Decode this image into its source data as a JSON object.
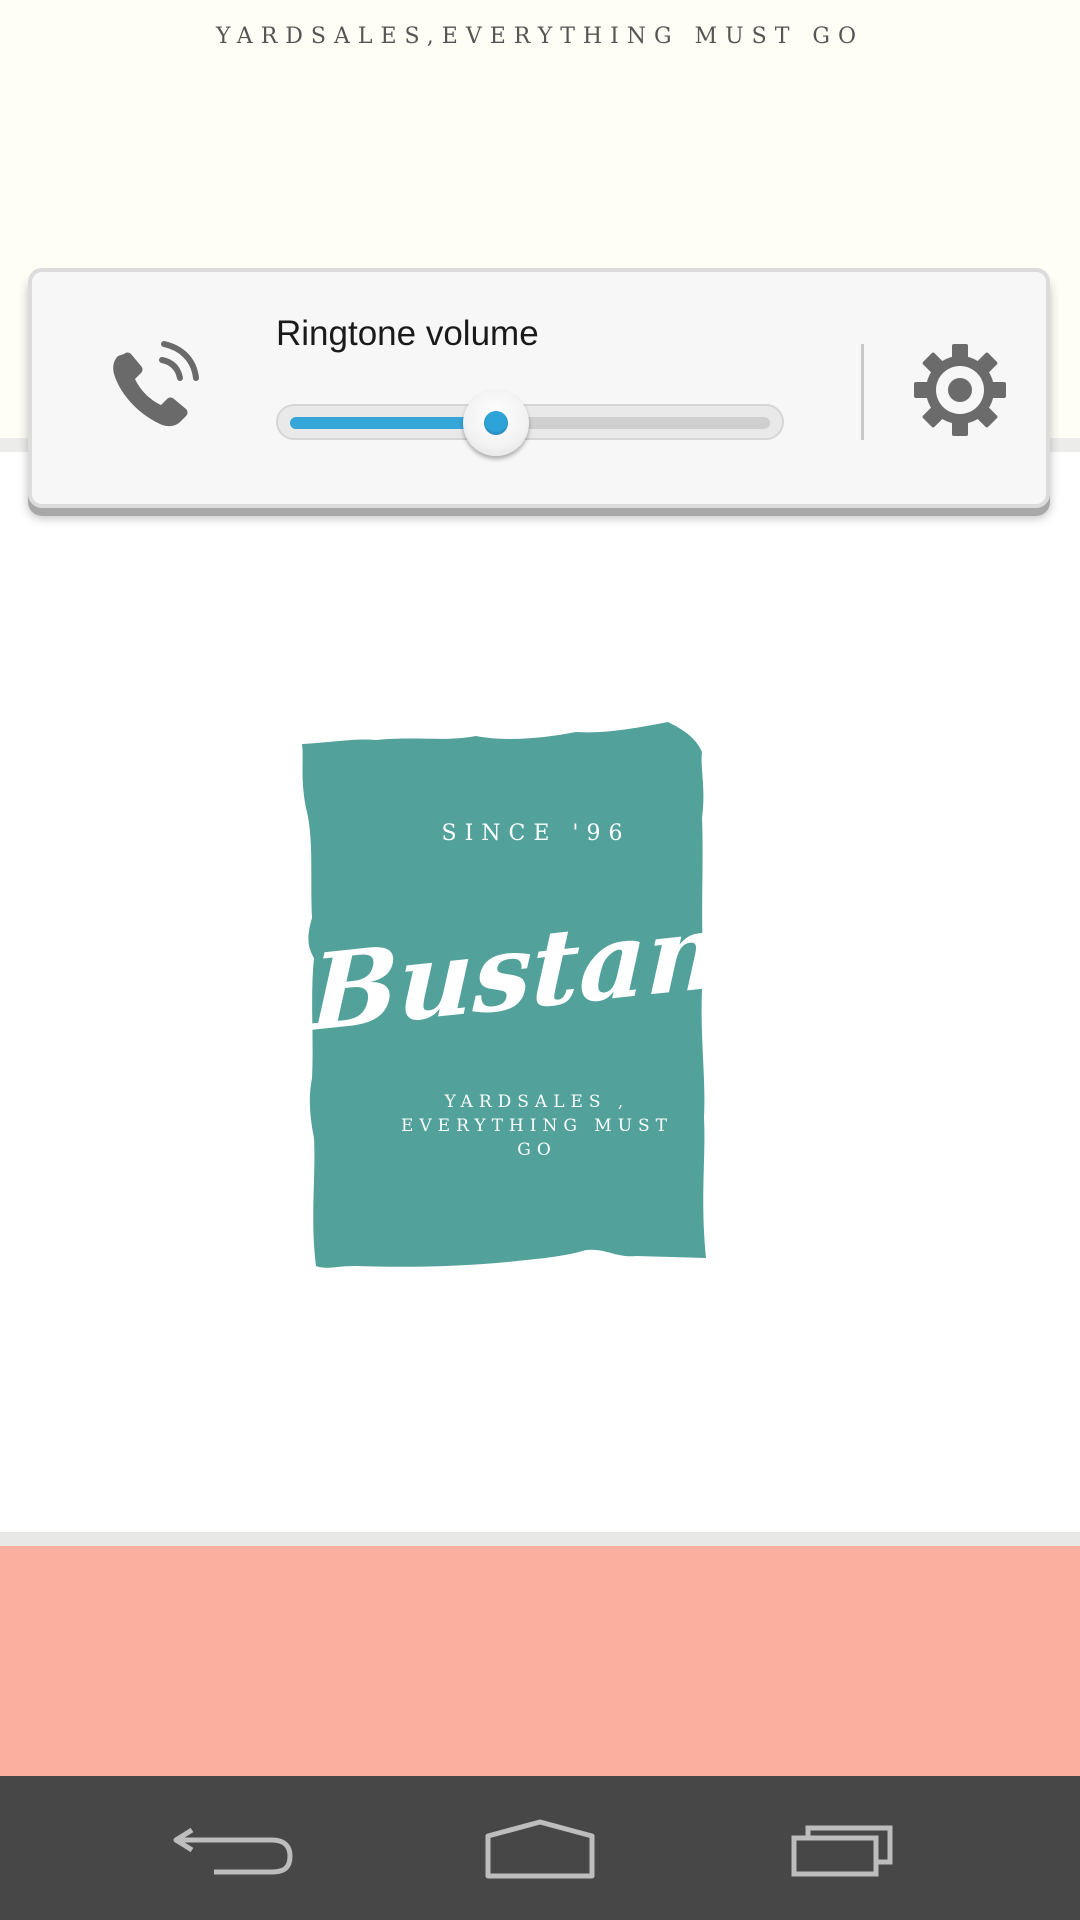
{
  "app": {
    "tagline": "YARDSALES,EVERYTHING MUST GO"
  },
  "volume_dialog": {
    "label": "Ringtone volume",
    "level": 0.43,
    "icon": "phone-ringing-icon",
    "settings_icon": "gear-icon",
    "accent_color": "#35a6d8"
  },
  "logo": {
    "since": "SINCE '96",
    "name": "Bustani",
    "tagline": "YARDSALES , EVERYTHING MUST GO",
    "background_color": "#52a29b"
  },
  "colors": {
    "top_banner": "#fefef6",
    "pink_banner": "#fbaf9e",
    "nav_bar": "#474747"
  },
  "nav_bar": {
    "buttons": [
      {
        "name": "back",
        "icon": "back-icon"
      },
      {
        "name": "home",
        "icon": "home-icon"
      },
      {
        "name": "recents",
        "icon": "recents-icon"
      }
    ]
  }
}
